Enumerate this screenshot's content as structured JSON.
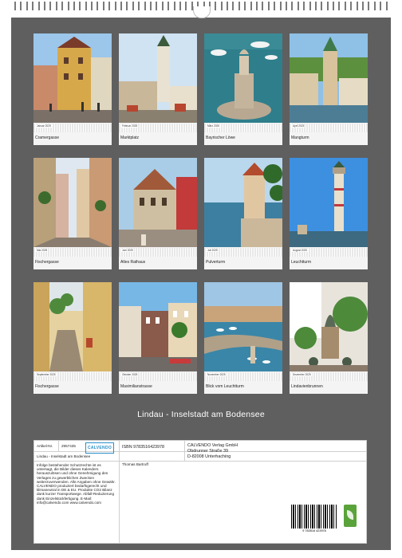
{
  "calendar": {
    "title": "Lindau - Inselstadt am Bodensee",
    "months": [
      {
        "label": "Januar 2025",
        "caption": "Cramergasse",
        "scene": "street-colorful"
      },
      {
        "label": "Februar 2025",
        "caption": "Marktplatz",
        "scene": "church-tower"
      },
      {
        "label": "März 2025",
        "caption": "Bayrischer Löwe",
        "scene": "harbor-lion"
      },
      {
        "label": "April 2025",
        "caption": "Mangturm",
        "scene": "tower-green-roof"
      },
      {
        "label": "Mai 2025",
        "caption": "Fischergasse",
        "scene": "narrow-lane"
      },
      {
        "label": "Juni 2025",
        "caption": "Altes Rathaus",
        "scene": "town-hall"
      },
      {
        "label": "Juli 2025",
        "caption": "Pulverturm",
        "scene": "lake-tower"
      },
      {
        "label": "August 2025",
        "caption": "Leuchtturm",
        "scene": "lighthouse"
      },
      {
        "label": "September 2025",
        "caption": "Fischergasse",
        "scene": "narrow-lane-2"
      },
      {
        "label": "Oktober 2025",
        "caption": "Maximilianstrasse",
        "scene": "street-wide"
      },
      {
        "label": "November 2025",
        "caption": "Blick vom Leuchtturm",
        "scene": "harbor-aerial"
      },
      {
        "label": "Dezember 2025",
        "caption": "Lindavienbrunnen",
        "scene": "fountain-statue"
      }
    ]
  },
  "info": {
    "article_label": "Artikel-Nr.",
    "article_no": "2957435",
    "product_title": "Lindau - Inselstadt am Bodensee",
    "publisher_logo": "CALVENDO",
    "isbn": "ISBN 9783516423978",
    "author": "Thomas Bartruff",
    "publisher_name": "CALVENDO Verlag GmbH",
    "publisher_street": "Obdrunner Straße 39",
    "publisher_city": "D-82008 Unterhaching",
    "legal_text": "Infolge bestehender Schutzrechte ist es untersagt, die Bilder dieses Kalenders herauszulösen und ohne Genehmigung des Verlages zu gewerblichen Zwecken weiterzuverwenden. Alle Angaben ohne Gewähr. CALVENDO produziert bedarfsgerecht und klimaneutral in DE & EU. Produkte CO2 Bilanz dank kurzer Transportwege. Abfall-Reduzierung dank Einzelstückfertigung. E-Mail: info@calvendo.com www.calvendo.com",
    "barcode_number": "9 783516 423978",
    "barcode_icon": "barcode",
    "eco_icon": "leaf-icon"
  },
  "colors": {
    "sheet": "#5f5f5f",
    "publisher_blue": "#2a8fc9",
    "eco_green": "#5aa33a"
  }
}
